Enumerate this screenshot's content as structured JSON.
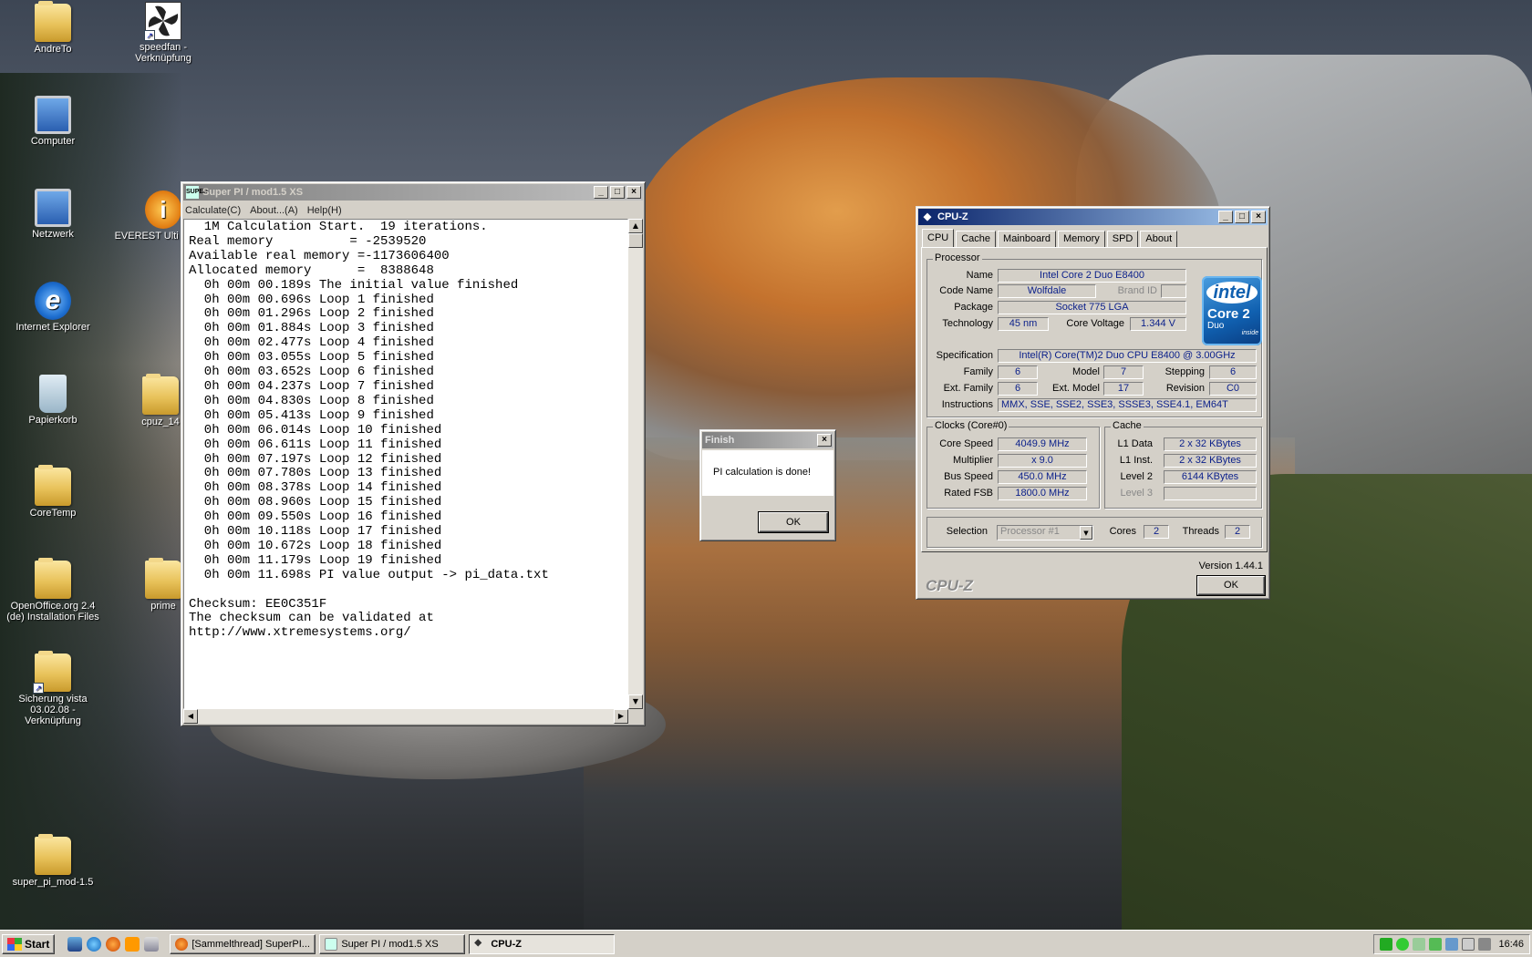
{
  "desktop": {
    "icons": [
      {
        "label": "AndreTo",
        "icon": "folder-icon"
      },
      {
        "label": "speedfan - Verknüpfung",
        "icon": "fan-icon"
      },
      {
        "label": "Computer",
        "icon": "computer-icon"
      },
      {
        "label": "Netzwerk",
        "icon": "network-icon"
      },
      {
        "label": "EVEREST Ulti Edition",
        "icon": "info-icon"
      },
      {
        "label": "Internet Explorer",
        "icon": "ie-icon"
      },
      {
        "label": "Papierkorb",
        "icon": "recycle-bin-icon"
      },
      {
        "label": "cpuz_14",
        "icon": "folder-icon"
      },
      {
        "label": "CoreTemp",
        "icon": "folder-icon"
      },
      {
        "label": "OpenOffice.org 2.4 (de) Installation Files",
        "icon": "folder-icon"
      },
      {
        "label": "prime",
        "icon": "folder-icon"
      },
      {
        "label": "Sicherung vista 03.02.08 - Verknüpfung",
        "icon": "folder-icon"
      },
      {
        "label": "super_pi_mod-1.5",
        "icon": "folder-icon"
      }
    ]
  },
  "superpi": {
    "title": "Super PI / mod1.5 XS",
    "icon_text": "SUPER",
    "menu": [
      "Calculate(C)",
      "About...(A)",
      "Help(H)"
    ],
    "output": [
      "  1M Calculation Start.  19 iterations.",
      "Real memory          = -2539520",
      "Available real memory =-1173606400",
      "Allocated memory      =  8388648",
      "  0h 00m 00.189s The initial value finished",
      "  0h 00m 00.696s Loop 1 finished",
      "  0h 00m 01.296s Loop 2 finished",
      "  0h 00m 01.884s Loop 3 finished",
      "  0h 00m 02.477s Loop 4 finished",
      "  0h 00m 03.055s Loop 5 finished",
      "  0h 00m 03.652s Loop 6 finished",
      "  0h 00m 04.237s Loop 7 finished",
      "  0h 00m 04.830s Loop 8 finished",
      "  0h 00m 05.413s Loop 9 finished",
      "  0h 00m 06.014s Loop 10 finished",
      "  0h 00m 06.611s Loop 11 finished",
      "  0h 00m 07.197s Loop 12 finished",
      "  0h 00m 07.780s Loop 13 finished",
      "  0h 00m 08.378s Loop 14 finished",
      "  0h 00m 08.960s Loop 15 finished",
      "  0h 00m 09.550s Loop 16 finished",
      "  0h 00m 10.118s Loop 17 finished",
      "  0h 00m 10.672s Loop 18 finished",
      "  0h 00m 11.179s Loop 19 finished",
      "  0h 00m 11.698s PI value output -> pi_data.txt",
      "",
      "Checksum: EE0C351F",
      "The checksum can be validated at",
      "http://www.xtremesystems.org/"
    ]
  },
  "finish": {
    "title": "Finish",
    "message": "PI calculation is done!",
    "ok": "OK"
  },
  "cpuz": {
    "title": "CPU-Z",
    "tabs": [
      "CPU",
      "Cache",
      "Mainboard",
      "Memory",
      "SPD",
      "About"
    ],
    "processor": {
      "group": "Processor",
      "name_label": "Name",
      "name": "Intel Core 2 Duo E8400",
      "codename_label": "Code Name",
      "codename": "Wolfdale",
      "brandid_label": "Brand ID",
      "brandid": "",
      "package_label": "Package",
      "package": "Socket 775 LGA",
      "tech_label": "Technology",
      "tech": "45 nm",
      "voltage_label": "Core Voltage",
      "voltage": "1.344 V",
      "spec_label": "Specification",
      "spec": "Intel(R) Core(TM)2 Duo CPU     E8400  @ 3.00GHz",
      "family_label": "Family",
      "family": "6",
      "model_label": "Model",
      "model": "7",
      "stepping_label": "Stepping",
      "stepping": "6",
      "extfamily_label": "Ext. Family",
      "extfamily": "6",
      "extmodel_label": "Ext. Model",
      "extmodel": "17",
      "revision_label": "Revision",
      "revision": "C0",
      "instr_label": "Instructions",
      "instr": "MMX, SSE, SSE2, SSE3, SSSE3, SSE4.1, EM64T"
    },
    "logo": {
      "brand": "intel",
      "line": "Core 2",
      "sub": "Duo",
      "tag": "inside"
    },
    "clocks": {
      "group": "Clocks (Core#0)",
      "corespeed_label": "Core Speed",
      "corespeed": "4049.9 MHz",
      "multiplier_label": "Multiplier",
      "multiplier": "x 9.0",
      "busspeed_label": "Bus Speed",
      "busspeed": "450.0 MHz",
      "fsb_label": "Rated FSB",
      "fsb": "1800.0 MHz"
    },
    "cache": {
      "group": "Cache",
      "l1d_label": "L1 Data",
      "l1d": "2 x 32 KBytes",
      "l1i_label": "L1 Inst.",
      "l1i": "2 x 32 KBytes",
      "l2_label": "Level 2",
      "l2": "6144 KBytes",
      "l3_label": "Level 3",
      "l3": ""
    },
    "selection_label": "Selection",
    "selection": "Processor #1",
    "cores_label": "Cores",
    "cores": "2",
    "threads_label": "Threads",
    "threads": "2",
    "version": "Version 1.44.1",
    "brand": "CPU-Z",
    "ok": "OK"
  },
  "taskbar": {
    "start": "Start",
    "tasks": [
      "[Sammelthread] SuperPI...",
      "Super PI / mod1.5 XS",
      "CPU-Z"
    ],
    "clock": "16:46"
  }
}
